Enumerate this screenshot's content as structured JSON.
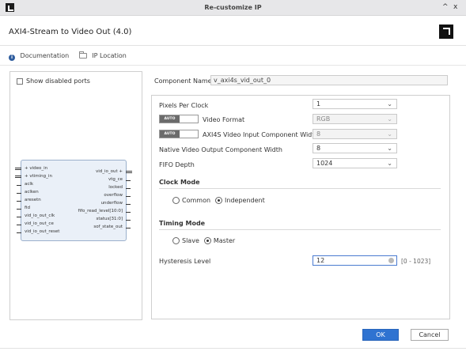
{
  "window": {
    "title": "Re-customize IP",
    "controls": {
      "collapse": "^",
      "close": "x"
    }
  },
  "ip": {
    "name": "AXI4-Stream to Video Out (4.0)"
  },
  "links": {
    "documentation": "Documentation",
    "ip_location": "IP Location"
  },
  "left": {
    "show_disabled_ports": "Show disabled ports",
    "block": {
      "left_pins": [
        "video_in",
        "vtiming_in",
        "aclk",
        "aclken",
        "aresetn",
        "fid",
        "vid_io_out_clk",
        "vid_io_out_ce",
        "vid_io_out_reset"
      ],
      "right_pins": [
        "vid_io_out",
        "vtg_ce",
        "locked",
        "overflow",
        "underflow",
        "fifo_read_level[10:0]",
        "status[31:0]",
        "sof_state_out"
      ]
    }
  },
  "component": {
    "label": "Component Name",
    "value": "v_axi4s_vid_out_0"
  },
  "params": {
    "pixels_per_clock": {
      "label": "Pixels Per Clock",
      "value": "1"
    },
    "video_format": {
      "label": "Video Format",
      "value": "RGB",
      "toggle": "AUTO"
    },
    "axi4s_width": {
      "label": "AXI4S Video Input Component Width",
      "value": "8",
      "toggle": "AUTO"
    },
    "native_width": {
      "label": "Native Video Output Component Width",
      "value": "8"
    },
    "fifo_depth": {
      "label": "FIFO Depth",
      "value": "1024"
    }
  },
  "clock_mode": {
    "title": "Clock Mode",
    "options": [
      "Common",
      "Independent"
    ],
    "selected": "Independent"
  },
  "timing_mode": {
    "title": "Timing Mode",
    "options": [
      "Slave",
      "Master"
    ],
    "selected": "Master"
  },
  "hysteresis": {
    "label": "Hysteresis Level",
    "value": "12",
    "range": "[0 - 1023]"
  },
  "buttons": {
    "ok": "OK",
    "cancel": "Cancel"
  },
  "colors": {
    "primary": "#2f73d1",
    "titlebar": "#e7e7e9",
    "block_fill": "#eaf0f8"
  }
}
